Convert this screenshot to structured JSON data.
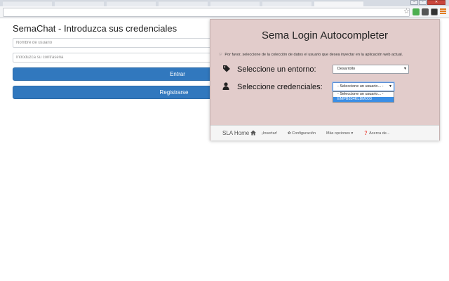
{
  "page": {
    "title": "SemaChat - Introduzca sus credenciales",
    "username_placeholder": "Nombre de usuario",
    "password_placeholder": "Introduzca su contraseña",
    "login_button": "Entrar",
    "register_button": "Registrarse"
  },
  "popup": {
    "title": "Sema Login Autocompleter",
    "info_text": "Por favor, seleccione de la colección de datos el usuario que desea inyectar en la aplicación web actual.",
    "environment_label": "Seleccione un entorno:",
    "environment_value": "Desarrollo",
    "credentials_label": "Seleccione credenciales:",
    "credentials_value": "- Seleccione un usuario... -",
    "credential_options": [
      "- Seleccione un usuario... -",
      "EMPB834KLBM003"
    ],
    "selected_option_index": 1
  },
  "nav": {
    "brand": "SLA Home",
    "items": [
      {
        "icon": "",
        "label": "¡Insertar!"
      },
      {
        "icon": "✿",
        "label": "Configuración"
      },
      {
        "icon": "",
        "label": "Más opciones ▾"
      },
      {
        "icon": "❓",
        "label": "Acerca de..."
      }
    ]
  },
  "colors": {
    "primary_button": "#3178be",
    "popup_background": "#e2cccb",
    "selected_option": "#3a8ee6"
  }
}
